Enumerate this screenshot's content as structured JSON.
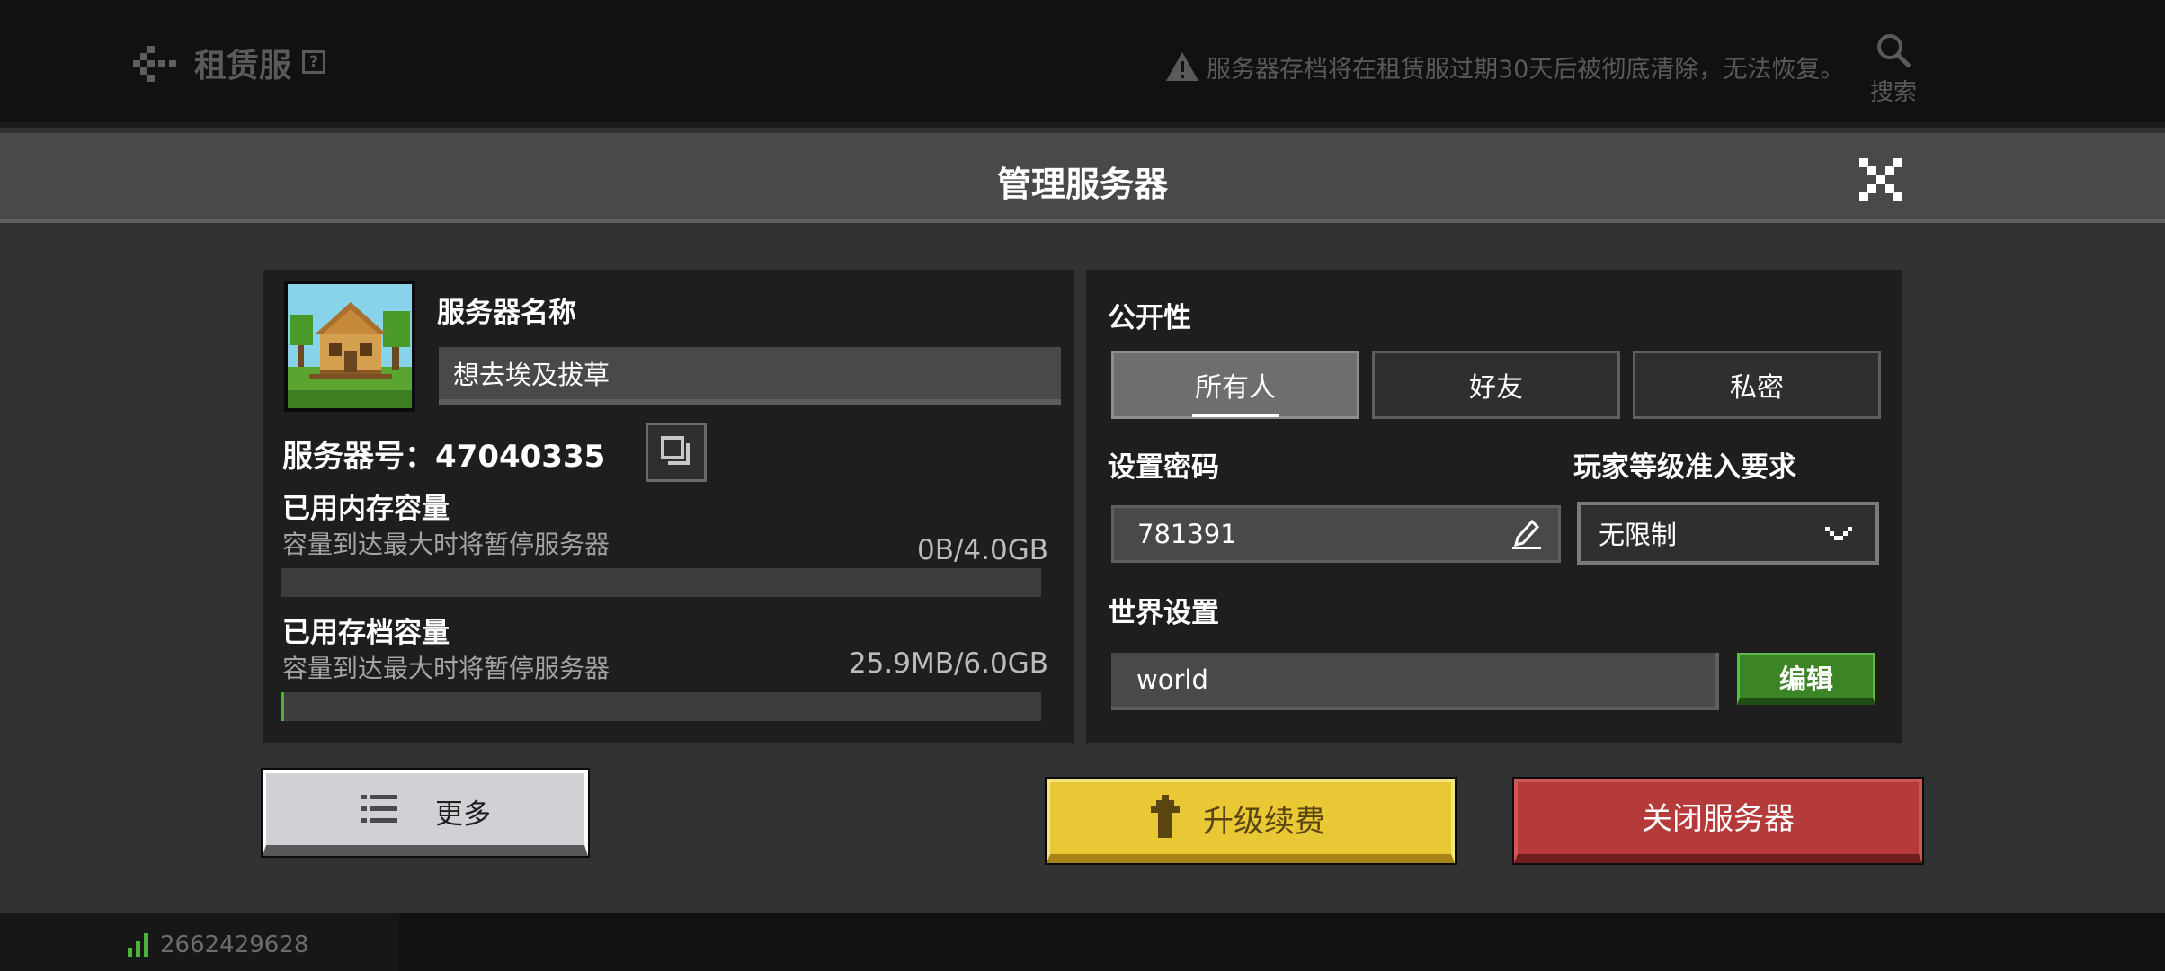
{
  "topbar": {
    "title": "租赁服",
    "help_glyph": "?",
    "warning": "服务器存档将在租赁服过期30天后被彻底清除，无法恢复。",
    "search_label": "搜索"
  },
  "modal": {
    "title": "管理服务器"
  },
  "server": {
    "name_label": "服务器名称",
    "name_value": "想去埃及拔草",
    "id_text": "服务器号：47040335"
  },
  "memory": {
    "label": "已用内存容量",
    "hint": "容量到达最大时将暂停服务器",
    "value": "0B/4.0GB",
    "fraction": 0.0
  },
  "storage": {
    "label": "已用存档容量",
    "hint": "容量到达最大时将暂停服务器",
    "value": "25.9MB/6.0GB",
    "fraction": 0.0042
  },
  "visibility": {
    "label": "公开性",
    "options": [
      "所有人",
      "好友",
      "私密"
    ],
    "selected": "所有人"
  },
  "password": {
    "label": "设置密码",
    "value": "781391"
  },
  "level_requirement": {
    "label": "玩家等级准入要求",
    "selected": "无限制"
  },
  "world": {
    "label": "世界设置",
    "value": "world",
    "edit_label": "编辑"
  },
  "actions": {
    "more": "更多",
    "upgrade": "升级续费",
    "shutdown": "关闭服务器"
  },
  "footer": {
    "user_id": "2662429628"
  },
  "colors": {
    "accent_green": "#3c8527",
    "upgrade_yellow": "#e8c935",
    "shutdown_red": "#b53a3a"
  }
}
